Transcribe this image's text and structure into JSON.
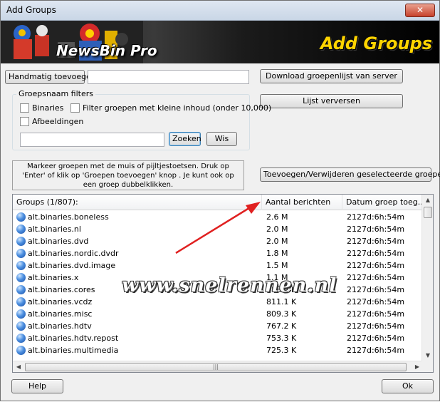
{
  "window": {
    "title": "Add Groups",
    "close_label": "✕"
  },
  "banner": {
    "app_name": "NewsBin Pro",
    "heading": "Add Groups"
  },
  "manual": {
    "button": "Handmatig toevoegen",
    "input_value": ""
  },
  "buttons": {
    "download": "Download groepenlijst van server",
    "refresh": "Lijst verversen",
    "add_remove": "Toevoegen/Verwijderen geselecteerde groepen",
    "help": "Help",
    "ok": "Ok"
  },
  "filters": {
    "label": "Groepsnaam filters",
    "binaries": "Binaries",
    "filter_small": "Filter groepen met kleine inhoud (onder 10,000)",
    "images": "Afbeeldingen",
    "search_value": "",
    "search_button": "Zoeken",
    "clear_button": "Wis"
  },
  "info_text": "Markeer groepen met de muis of pijltjestoetsen. Druk op 'Enter' of klik op 'Groepen toevoegen' knop . Je kunt ook op een groep dubbelklikken.",
  "list": {
    "headers": [
      "Groups (1/807):",
      "Aantal berichten",
      "Datum groep toeg..."
    ],
    "rows": [
      {
        "name": "alt.binaries.boneless",
        "count": "2.6 M",
        "date": "2127d:6h:54m"
      },
      {
        "name": "alt.binaries.nl",
        "count": "2.0 M",
        "date": "2127d:6h:54m"
      },
      {
        "name": "alt.binaries.dvd",
        "count": "2.0 M",
        "date": "2127d:6h:54m"
      },
      {
        "name": "alt.binaries.nordic.dvdr",
        "count": "1.8 M",
        "date": "2127d:6h:54m"
      },
      {
        "name": "alt.binaries.dvd.image",
        "count": "1.5 M",
        "date": "2127d:6h:54m"
      },
      {
        "name": "alt.binaries.x",
        "count": "1.1 M",
        "date": "2127d:6h:54m"
      },
      {
        "name": "alt.binaries.cores",
        "count": "958.6 K",
        "date": "2127d:6h:54m"
      },
      {
        "name": "alt.binaries.vcdz",
        "count": "811.1 K",
        "date": "2127d:6h:54m"
      },
      {
        "name": "alt.binaries.misc",
        "count": "809.3 K",
        "date": "2127d:6h:54m"
      },
      {
        "name": "alt.binaries.hdtv",
        "count": "767.2 K",
        "date": "2127d:6h:54m"
      },
      {
        "name": "alt.binaries.hdtv.repost",
        "count": "753.3 K",
        "date": "2127d:6h:54m"
      },
      {
        "name": "alt.binaries.multimedia",
        "count": "725.3 K",
        "date": "2127d:6h:54m"
      }
    ]
  },
  "watermark": "www.snelrennen.nl",
  "colors": {
    "arrow": "#e02020",
    "banner_heading": "#ffd400"
  }
}
